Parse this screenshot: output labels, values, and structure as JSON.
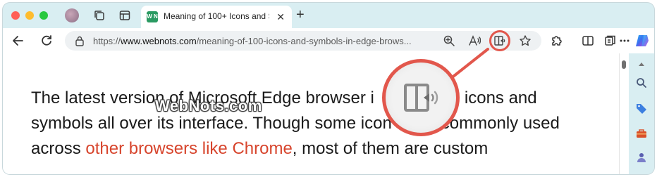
{
  "tab": {
    "title": "Meaning of 100+ Icons and Sy",
    "favicon_text": "W N",
    "close_glyph": "✕",
    "new_tab_glyph": "+"
  },
  "address_bar": {
    "url_prefix": "https://",
    "url_domain": "www.webnots.com",
    "url_path": "/meaning-of-100-icons-and-symbols-in-edge-brows..."
  },
  "content": {
    "line1": "The latest version of Microsoft Edge browser i",
    "line1_tail": "h icons and",
    "line2": "symbols all over its interface. Though some icon",
    "line2_tail": "commonly used",
    "line3_prefix": "across ",
    "line3_link": "other browsers like Chrome",
    "line3_suffix": ", most of them are custom"
  },
  "watermark": "WebNots.com",
  "colors": {
    "accent": "#e2574c",
    "link": "#d7452d",
    "chrome_bg": "#d9eef2"
  },
  "icons": {
    "toolbar": [
      "back-icon",
      "refresh-icon",
      "lock-icon",
      "zoom-icon",
      "read-aloud-icon",
      "immersive-reader-icon",
      "favorite-star-icon",
      "extensions-icon",
      "split-screen-icon",
      "collections-icon",
      "more-icon",
      "copilot-icon"
    ],
    "sidebar": [
      "scroll-up-icon",
      "search-icon",
      "shopping-tag-icon",
      "tools-icon",
      "games-icon"
    ]
  }
}
